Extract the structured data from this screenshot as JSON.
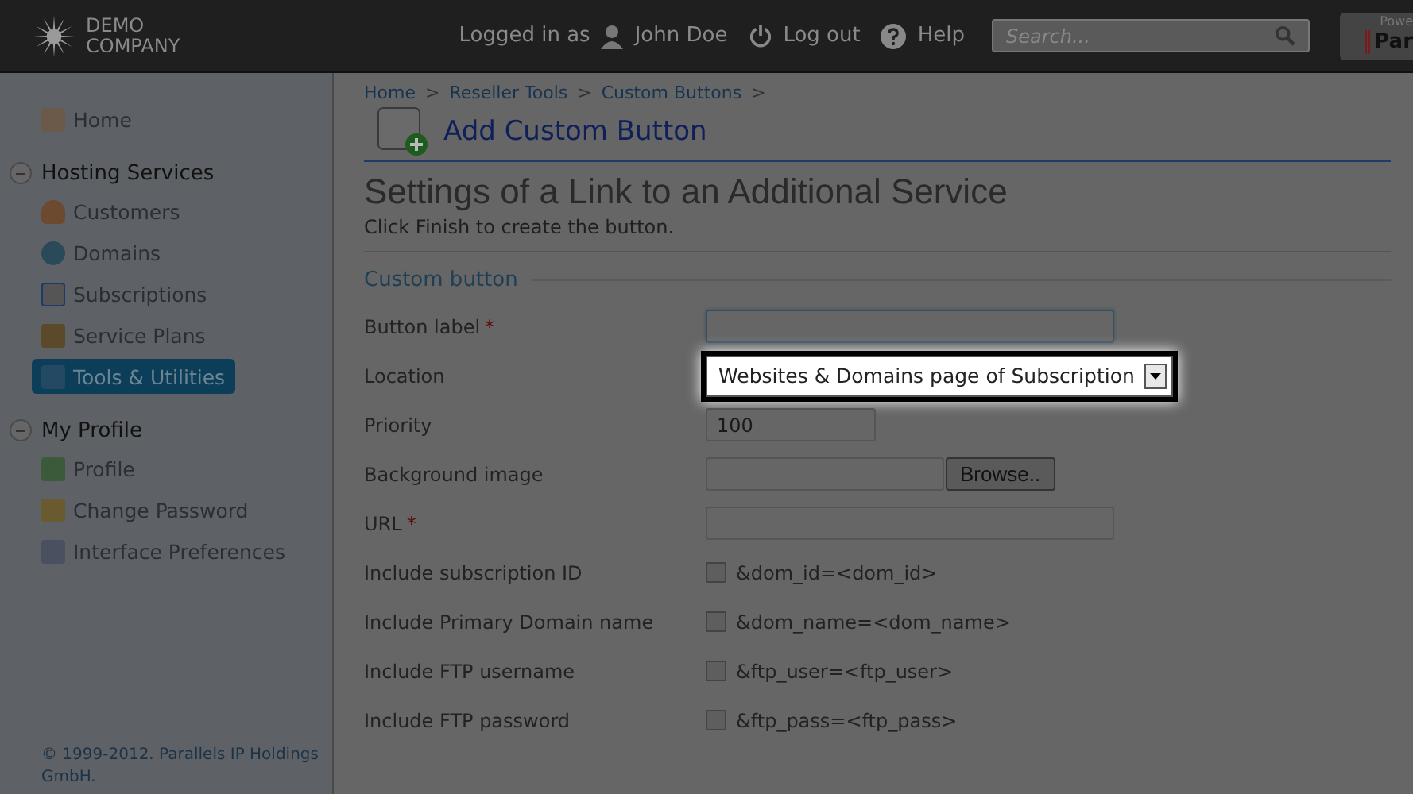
{
  "header": {
    "logo": [
      "DEMO",
      "COMPANY"
    ],
    "logged_in_label": "Logged in as",
    "user": "John Doe",
    "logout": "Log out",
    "help": "Help",
    "search": {
      "placeholder": "Search..."
    },
    "powered": {
      "line_1": "Powe",
      "line_2": "Par"
    }
  },
  "sidebar": {
    "items": [
      {
        "kind": "link",
        "label": "Home",
        "selected": false
      },
      {
        "kind": "group",
        "label": "Hosting Services",
        "expanded": true,
        "children": [
          {
            "label": "Customers",
            "selected": false
          },
          {
            "label": "Domains",
            "selected": false
          },
          {
            "label": "Subscriptions",
            "selected": false
          },
          {
            "label": "Service Plans",
            "selected": false
          },
          {
            "label": "Tools & Utilities",
            "selected": true
          }
        ]
      },
      {
        "kind": "group",
        "label": "My Profile",
        "expanded": true,
        "children": [
          {
            "label": "Profile",
            "selected": false
          },
          {
            "label": "Change Password",
            "selected": false
          },
          {
            "label": "Interface Preferences",
            "selected": false
          }
        ]
      }
    ],
    "footer": "© 1999-2012. Parallels IP Holdings GmbH."
  },
  "breadcrumbs": [
    "Home",
    "Reseller Tools",
    "Custom Buttons"
  ],
  "breadcrumb_separator": ">",
  "page_title": "Add Custom Button",
  "heading": "Settings of a Link to an Additional Service",
  "intro": "Click Finish to create the button.",
  "section": "Custom button",
  "fields": [
    {
      "kind": "text",
      "label": "Button label",
      "required_mark": "*",
      "focused": true
    },
    {
      "kind": "select",
      "label": "Location",
      "value": "Websites & Domains page of Subscription",
      "highlighted": true
    },
    {
      "kind": "short",
      "label": "Priority",
      "value": "100"
    },
    {
      "kind": "file",
      "label": "Background image",
      "button": "Browse.."
    },
    {
      "kind": "text",
      "label": "URL",
      "required_mark": "*",
      "focused": false
    },
    {
      "kind": "checkbox",
      "label": "Include subscription ID",
      "text": "&dom_id=<dom_id>",
      "checked": false
    },
    {
      "kind": "checkbox",
      "label": "Include Primary Domain name",
      "text": "&dom_name=<dom_name>",
      "checked": false
    },
    {
      "kind": "checkbox",
      "label": "Include FTP username",
      "text": "&ftp_user=<ftp_user>",
      "checked": false
    },
    {
      "kind": "checkbox",
      "label": "Include FTP password",
      "text": "&ftp_pass=<ftp_pass>",
      "checked": false
    }
  ]
}
